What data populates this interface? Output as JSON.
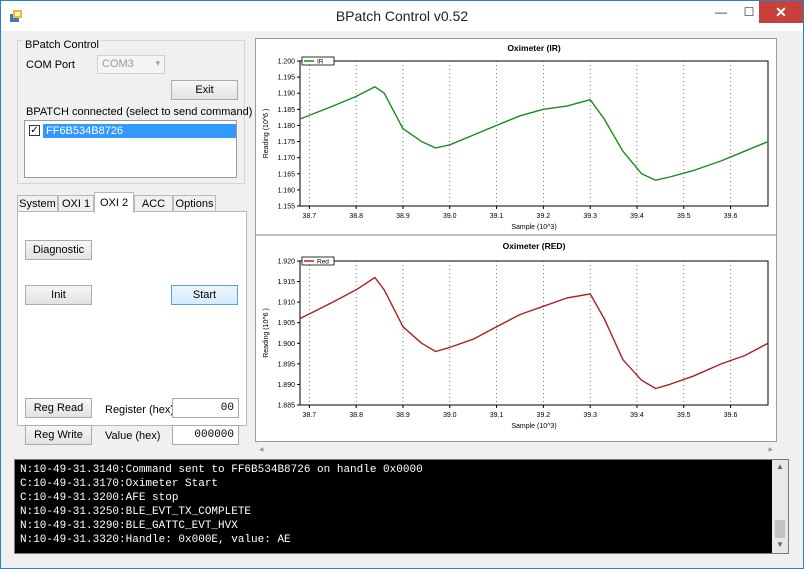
{
  "window": {
    "title": "BPatch Control v0.52",
    "minimize_glyph": "—",
    "maximize_glyph": "☐",
    "close_glyph": "✕"
  },
  "bpatch_control": {
    "legend": "BPatch Control",
    "com_port_label": "COM Port",
    "com_port_value": "COM3",
    "exit_label": "Exit",
    "connected_label": "BPATCH connected (select to send command)",
    "devices": [
      {
        "name": "FF6B534B8726",
        "checked": true
      }
    ]
  },
  "tabs": [
    {
      "label": "System",
      "active": false
    },
    {
      "label": "OXI 1",
      "active": false
    },
    {
      "label": "OXI 2",
      "active": true
    },
    {
      "label": "ACC",
      "active": false
    },
    {
      "label": "Options",
      "active": false
    }
  ],
  "oxi2": {
    "diagnostic_label": "Diagnostic",
    "init_label": "Init",
    "start_label": "Start",
    "reg_read_label": "Reg Read",
    "reg_write_label": "Reg Write",
    "register_label": "Register (hex)",
    "register_value": "00",
    "value_label": "Value (hex)",
    "value_value": "000000"
  },
  "chart_data": [
    {
      "type": "line",
      "title": "Oximeter (IR)",
      "xlabel": "Sample (10^3)",
      "ylabel": "Reading (10^6 )",
      "legend": "IR",
      "legend_position": "top-left",
      "color": "#1a8c1a",
      "grid": true,
      "xlim": [
        38.68,
        39.68
      ],
      "ylim": [
        1.155,
        1.2
      ],
      "xticks": [
        "38.7",
        "38.8",
        "38.9",
        "39.0",
        "39.1",
        "39.2",
        "39.3",
        "39.4",
        "39.5",
        "39.6"
      ],
      "yticks": [
        "1.155",
        "1.160",
        "1.165",
        "1.170",
        "1.175",
        "1.180",
        "1.185",
        "1.190",
        "1.195",
        "1.200"
      ],
      "x": [
        38.68,
        38.75,
        38.8,
        38.84,
        38.86,
        38.9,
        38.94,
        38.97,
        39.0,
        39.05,
        39.1,
        39.15,
        39.2,
        39.25,
        39.3,
        39.33,
        39.37,
        39.41,
        39.44,
        39.47,
        39.52,
        39.58,
        39.63,
        39.68
      ],
      "y": [
        1.182,
        1.186,
        1.189,
        1.192,
        1.19,
        1.179,
        1.175,
        1.173,
        1.174,
        1.177,
        1.18,
        1.183,
        1.185,
        1.186,
        1.188,
        1.182,
        1.172,
        1.165,
        1.163,
        1.164,
        1.166,
        1.169,
        1.172,
        1.175
      ]
    },
    {
      "type": "line",
      "title": "Oximeter (RED)",
      "xlabel": "Sample (10^3)",
      "ylabel": "Reading (10^6 )",
      "legend": "Red",
      "legend_position": "top-left",
      "color": "#b02020",
      "grid": true,
      "xlim": [
        38.68,
        39.68
      ],
      "ylim": [
        1.885,
        1.92
      ],
      "xticks": [
        "38.7",
        "38.8",
        "38.9",
        "39.0",
        "39.1",
        "39.2",
        "39.3",
        "39.4",
        "39.5",
        "39.6"
      ],
      "yticks": [
        "1.885",
        "1.890",
        "1.895",
        "1.900",
        "1.905",
        "1.910",
        "1.915",
        "1.920"
      ],
      "x": [
        38.68,
        38.75,
        38.8,
        38.84,
        38.86,
        38.9,
        38.94,
        38.97,
        39.0,
        39.05,
        39.1,
        39.15,
        39.2,
        39.25,
        39.3,
        39.33,
        39.37,
        39.41,
        39.44,
        39.47,
        39.52,
        39.58,
        39.63,
        39.68
      ],
      "y": [
        1.906,
        1.91,
        1.913,
        1.916,
        1.913,
        1.904,
        1.9,
        1.898,
        1.899,
        1.901,
        1.904,
        1.907,
        1.909,
        1.911,
        1.912,
        1.906,
        1.896,
        1.891,
        1.889,
        1.89,
        1.892,
        1.895,
        1.897,
        1.9
      ]
    }
  ],
  "log": [
    "N:10-49-31.3140:Command sent to FF6B534B8726 on handle 0x0000",
    "C:10-49-31.3170:Oximeter Start",
    "C:10-49-31.3200:AFE stop",
    "N:10-49-31.3250:BLE_EVT_TX_COMPLETE",
    "N:10-49-31.3290:BLE_GATTC_EVT_HVX",
    "N:10-49-31.3320:Handle: 0x000E, value: AE"
  ],
  "icons": {
    "app": "app-icon",
    "scroll_left": "◂",
    "scroll_right": "▸",
    "scroll_up": "▲",
    "scroll_down": "▼",
    "dropdown": "▾",
    "check": "✓"
  }
}
